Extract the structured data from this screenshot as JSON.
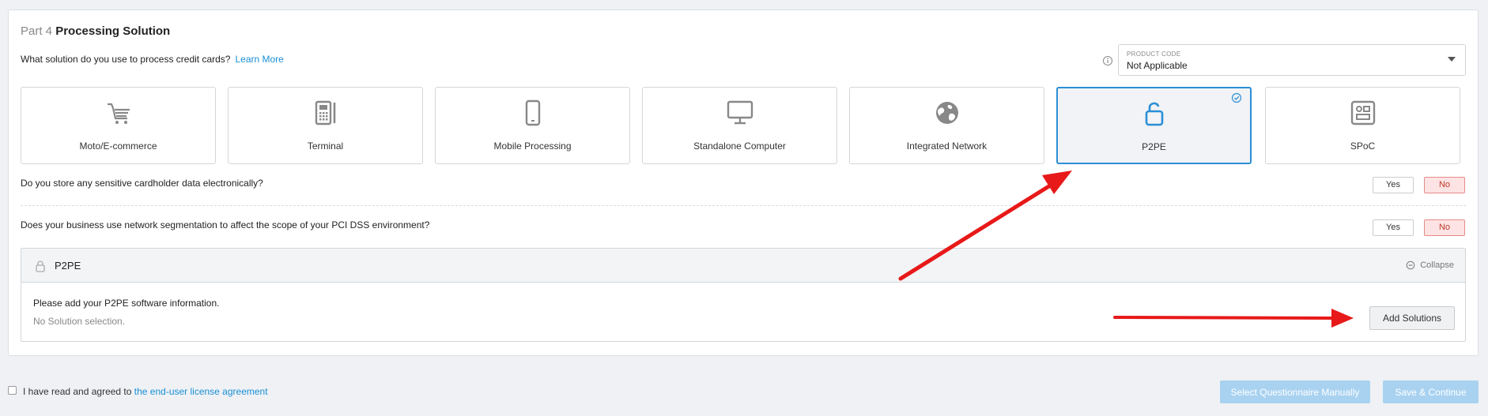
{
  "section": {
    "part_label": "Part 4",
    "title": "Processing Solution"
  },
  "question_solution": {
    "text": "What solution do you use to process credit cards?",
    "learn_more": "Learn More"
  },
  "product_code": {
    "label": "PRODUCT CODE",
    "value": "Not Applicable"
  },
  "cards": [
    {
      "label": "Moto/E-commerce",
      "icon": "shopping-cart-icon",
      "selected": false
    },
    {
      "label": "Terminal",
      "icon": "terminal-icon",
      "selected": false
    },
    {
      "label": "Mobile Processing",
      "icon": "mobile-phone-icon",
      "selected": false
    },
    {
      "label": "Standalone Computer",
      "icon": "monitor-icon",
      "selected": false
    },
    {
      "label": "Integrated Network",
      "icon": "globe-icon",
      "selected": false
    },
    {
      "label": "P2PE",
      "icon": "unlock-icon",
      "selected": true
    },
    {
      "label": "SPoC",
      "icon": "spoc-device-icon",
      "selected": false
    }
  ],
  "question_store": {
    "text": "Do you store any sensitive cardholder data electronically?",
    "yes": "Yes",
    "no": "No",
    "selected": "No"
  },
  "question_segmentation": {
    "text": "Does your business use network segmentation to affect the scope of your PCI DSS environment?",
    "yes": "Yes",
    "no": "No",
    "selected": "No"
  },
  "p2pe_section": {
    "title": "P2PE",
    "collapse": "Collapse",
    "instruction": "Please add your P2PE software information.",
    "empty_state": "No Solution selection.",
    "add_button": "Add Solutions"
  },
  "footer": {
    "agree_prefix": "I have read and agreed to",
    "agree_link": "the end-user license agreement",
    "select_manual": "Select Questionnaire Manually",
    "save_continue": "Save & Continue"
  },
  "colors": {
    "accent": "#2b8fd6",
    "link": "#1a8fd6",
    "no_selected_bg": "#fde3e3",
    "arrow": "#e81919",
    "disabled_button": "#a9d2f1"
  }
}
